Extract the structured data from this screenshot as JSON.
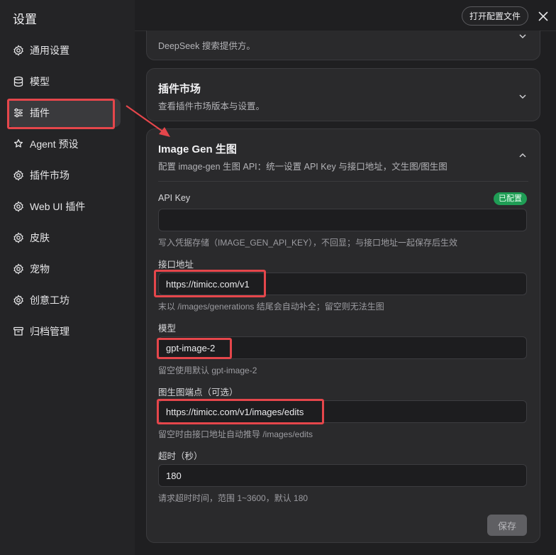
{
  "app_title": "设置",
  "header": {
    "open_config_label": "打开配置文件"
  },
  "sidebar": {
    "items": [
      {
        "label": "通用设置",
        "icon": "gear-icon"
      },
      {
        "label": "模型",
        "icon": "database-icon"
      },
      {
        "label": "插件",
        "icon": "sliders-icon",
        "active": true
      },
      {
        "label": "Agent 预设",
        "icon": "agent-icon"
      },
      {
        "label": "插件市场",
        "icon": "gear-icon"
      },
      {
        "label": "Web UI 插件",
        "icon": "gear-icon"
      },
      {
        "label": "皮肤",
        "icon": "gear-icon"
      },
      {
        "label": "宠物",
        "icon": "gear-icon"
      },
      {
        "label": "创意工坊",
        "icon": "gear-icon"
      },
      {
        "label": "归档管理",
        "icon": "archive-icon"
      }
    ]
  },
  "cards": {
    "top_partial": {
      "desc": "DeepSeek 搜索提供方。"
    },
    "market": {
      "title": "插件市场",
      "desc": "查看插件市场版本与设置。"
    },
    "image_gen": {
      "title": "Image Gen 生图",
      "desc": "配置 image-gen 生图 API：统一设置 API Key 与接口地址，文生图/图生图",
      "api_key": {
        "label": "API Key",
        "badge": "已配置",
        "value": "",
        "hint": "写入凭据存储（IMAGE_GEN_API_KEY），不回显；与接口地址一起保存后生效"
      },
      "endpoint": {
        "label": "接口地址",
        "value": "https://timicc.com/v1",
        "hint": "末以 /images/generations 结尾会自动补全；留空则无法生图"
      },
      "model": {
        "label": "模型",
        "value": "gpt-image-2",
        "hint": "留空使用默认 gpt-image-2"
      },
      "edit_endpoint": {
        "label": "图生图端点（可选）",
        "value": "https://timicc.com/v1/images/edits",
        "hint": "留空时由接口地址自动推导 /images/edits"
      },
      "timeout": {
        "label": "超时（秒）",
        "value": "180",
        "hint": "请求超时时间，范围 1~3600，默认 180"
      },
      "save_label": "保存"
    }
  },
  "colors": {
    "highlight": "#e5464b",
    "badge": "#1f9d55",
    "background": "#1f1f21"
  }
}
